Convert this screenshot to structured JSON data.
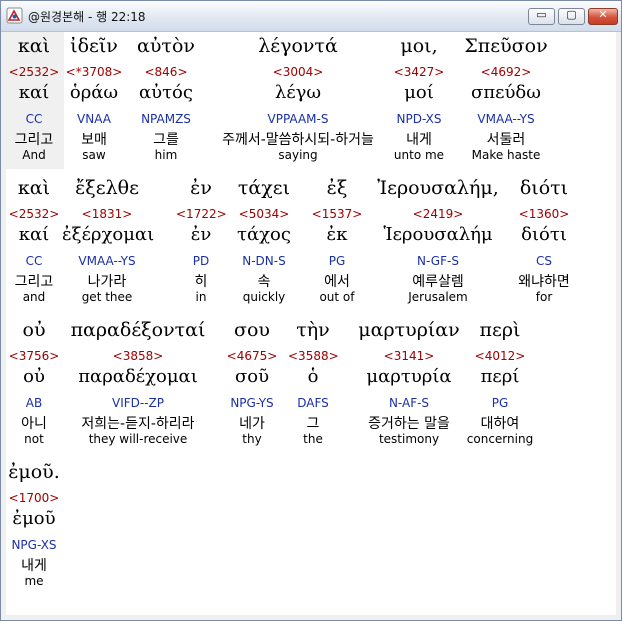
{
  "window": {
    "title": "@원경본해 - 행 22:18",
    "icon": "app-logo-icon",
    "buttons": {
      "minimize": "▭",
      "restore": "▢",
      "close": "✕"
    }
  },
  "lines": [
    [
      {
        "gk": "καὶ",
        "strong": "<2532>",
        "lemma": "καί",
        "morph": "CC",
        "kor": "그리고",
        "eng": "And"
      },
      {
        "gk": "ἰδεῖν",
        "strong": "<*3708>",
        "lemma": "ὁράω",
        "morph": "VNAA",
        "kor": "보매",
        "eng": "saw"
      },
      {
        "gk": "αὐτὸν",
        "strong": "<846>",
        "lemma": "αὐτός",
        "morph": "NPAMZS",
        "kor": "그를",
        "eng": "him"
      },
      {
        "gk": "λέγοντά",
        "strong": "<3004>",
        "lemma": "λέγω",
        "morph": "VPPAAM-S",
        "kor": "주께서-말씀하시되-하거늘",
        "eng": "saying"
      },
      {
        "gk": "μοι,",
        "strong": "<3427>",
        "lemma": "μοί",
        "morph": "NPD-XS",
        "kor": "내게",
        "eng": "unto me"
      },
      {
        "gk": "Σπεῦσον",
        "strong": "<4692>",
        "lemma": "σπεύδω",
        "morph": "VMAA--YS",
        "kor": "서둘러",
        "eng": "Make haste"
      }
    ],
    [
      {
        "gk": "καὶ",
        "strong": "<2532>",
        "lemma": "καί",
        "morph": "CC",
        "kor": "그리고",
        "eng": "and"
      },
      {
        "gk": "ἔξελθε",
        "strong": "<1831>",
        "lemma": "ἐξέρχομαι",
        "morph": "VMAA--YS",
        "kor": "나가라",
        "eng": "get thee"
      },
      {
        "gk": "ἐν",
        "strong": "<1722>",
        "lemma": "ἐν",
        "morph": "PD",
        "kor": "히",
        "eng": "in"
      },
      {
        "gk": "τάχει",
        "strong": "<5034>",
        "lemma": "τάχος",
        "morph": "N-DN-S",
        "kor": "속",
        "eng": "quickly"
      },
      {
        "gk": "ἐξ",
        "strong": "<1537>",
        "lemma": "ἐκ",
        "morph": "PG",
        "kor": "에서",
        "eng": "out of"
      },
      {
        "gk": "Ἰερουσαλήμ,",
        "strong": "<2419>",
        "lemma": "Ἱερουσαλήμ",
        "morph": "N-GF-S",
        "kor": "예루살렘",
        "eng": "Jerusalem"
      },
      {
        "gk": "διότι",
        "strong": "<1360>",
        "lemma": "διότι",
        "morph": "CS",
        "kor": "왜냐하면",
        "eng": "for"
      }
    ],
    [
      {
        "gk": "οὐ",
        "strong": "<3756>",
        "lemma": "οὐ",
        "morph": "AB",
        "kor": "아니",
        "eng": "not"
      },
      {
        "gk": "παραδέξονταί",
        "strong": "<3858>",
        "lemma": "παραδέχομαι",
        "morph": "VIFD--ZP",
        "kor": "저희는-듣지-하리라",
        "eng": "they will-receive"
      },
      {
        "gk": "σου",
        "strong": "<4675>",
        "lemma": "σοῦ",
        "morph": "NPG-YS",
        "kor": "네가",
        "eng": "thy"
      },
      {
        "gk": "τὴν",
        "strong": "<3588>",
        "lemma": "ὁ",
        "morph": "DAFS",
        "kor": "그",
        "eng": "the"
      },
      {
        "gk": "μαρτυρίαν",
        "strong": "<3141>",
        "lemma": "μαρτυρία",
        "morph": "N-AF-S",
        "kor": "증거하는 말을",
        "eng": "testimony"
      },
      {
        "gk": "περὶ",
        "strong": "<4012>",
        "lemma": "περί",
        "morph": "PG",
        "kor": "대하여",
        "eng": "concerning"
      }
    ],
    [
      {
        "gk": "ἐμοῦ.",
        "strong": "<1700>",
        "lemma": "ἐμοῦ",
        "morph": "NPG-XS",
        "kor": "내게",
        "eng": "me"
      }
    ]
  ]
}
